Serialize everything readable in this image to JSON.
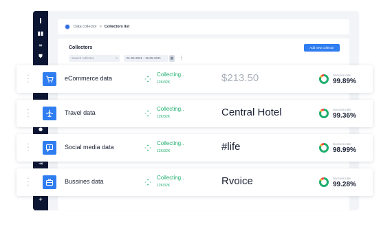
{
  "app": {
    "breadcrumb": {
      "root": "Data collector",
      "separator": ">",
      "current": "Collectors list"
    },
    "sidebar_icons": [
      "info-icon",
      "bar-chart-icon",
      "link-icon",
      "shield-icon",
      "clock-icon",
      "share-icon",
      "plus-icon"
    ],
    "panel": {
      "title": "Collectors",
      "search_placeholder": "Search collector",
      "date_range": "01-05-2021 - 15-05-2021",
      "more": "⋮",
      "add_button": "Add new collector"
    }
  },
  "accent_color": "#2f7df0",
  "status_color": "#1fae6d",
  "collectors": [
    {
      "name": "eCommerce data",
      "icon": "cart-icon",
      "status": "Collecting..",
      "progress": "12K/32K",
      "preview": "$213.50",
      "preview_faded": true,
      "rate_label": "Success rate",
      "rate_value": "99.89%",
      "rate_fraction": 0.9989
    },
    {
      "name": "Travel data",
      "icon": "airplane-icon",
      "status": "Collecting..",
      "progress": "12K/32K",
      "preview": "Central Hotel",
      "preview_faded": false,
      "rate_label": "Success rate",
      "rate_value": "99.36%",
      "rate_fraction": 0.9936
    },
    {
      "name": "Social media data",
      "icon": "chat-icon",
      "status": "Collecting..",
      "progress": "12K/32K",
      "preview": "#life",
      "preview_faded": false,
      "rate_label": "Success rate",
      "rate_value": "98.99%",
      "rate_fraction": 0.9899
    },
    {
      "name": "Bussines data",
      "icon": "briefcase-icon",
      "status": "Collecting..",
      "progress": "12K/32K",
      "preview": "Rvoice",
      "preview_faded": false,
      "rate_label": "Success rate",
      "rate_value": "99.28%",
      "rate_fraction": 0.9928
    }
  ]
}
